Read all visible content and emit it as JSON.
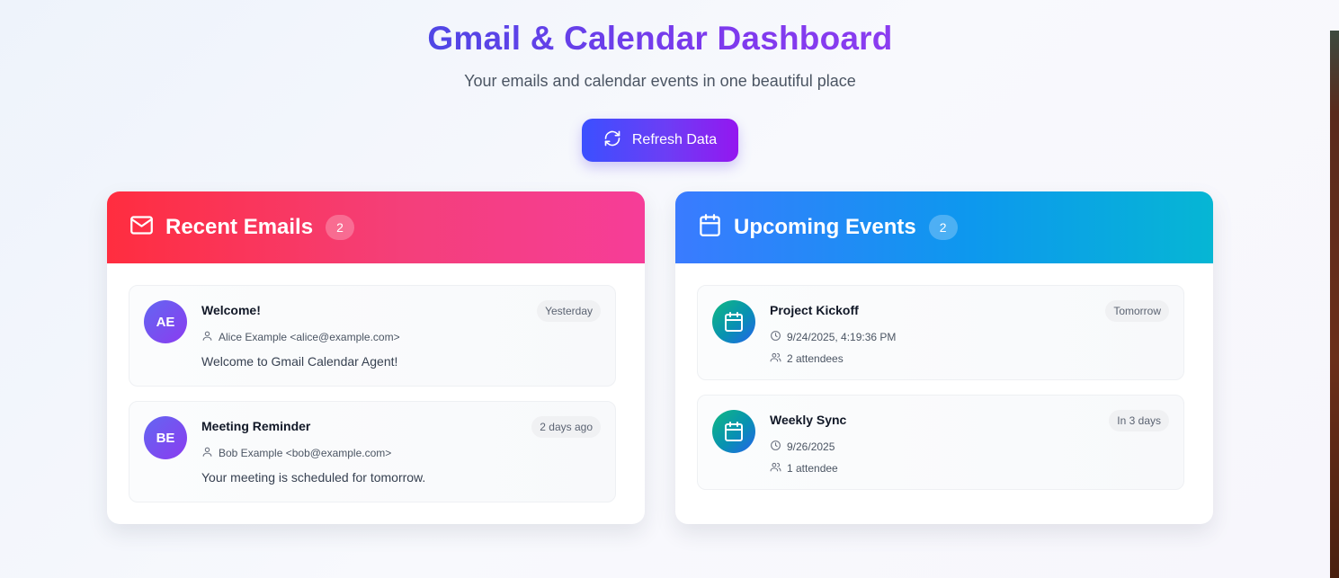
{
  "header": {
    "title": "Gmail & Calendar Dashboard",
    "subtitle": "Your emails and calendar events in one beautiful place"
  },
  "refresh_button": {
    "label": "Refresh Data",
    "icon": "refresh-icon"
  },
  "emails": {
    "title": "Recent Emails",
    "count": "2",
    "icon": "mail-icon",
    "items": [
      {
        "initials": "AE",
        "subject": "Welcome!",
        "time": "Yesterday",
        "sender": "Alice Example <alice@example.com>",
        "preview": "Welcome to Gmail Calendar Agent!"
      },
      {
        "initials": "BE",
        "subject": "Meeting Reminder",
        "time": "2 days ago",
        "sender": "Bob Example <bob@example.com>",
        "preview": "Your meeting is scheduled for tomorrow."
      }
    ]
  },
  "events": {
    "title": "Upcoming Events",
    "count": "2",
    "icon": "calendar-icon",
    "items": [
      {
        "title": "Project Kickoff",
        "time": "Tomorrow",
        "datetime": "9/24/2025, 4:19:36 PM",
        "attendees": "2 attendees"
      },
      {
        "title": "Weekly Sync",
        "time": "In 3 days",
        "datetime": "9/26/2025",
        "attendees": "1 attendee"
      }
    ]
  },
  "colors": {
    "email_header": "#ff2d3f",
    "event_header": "#0d98ee",
    "title_gradient_start": "#4f46e5",
    "title_gradient_end": "#8b3cf0"
  }
}
